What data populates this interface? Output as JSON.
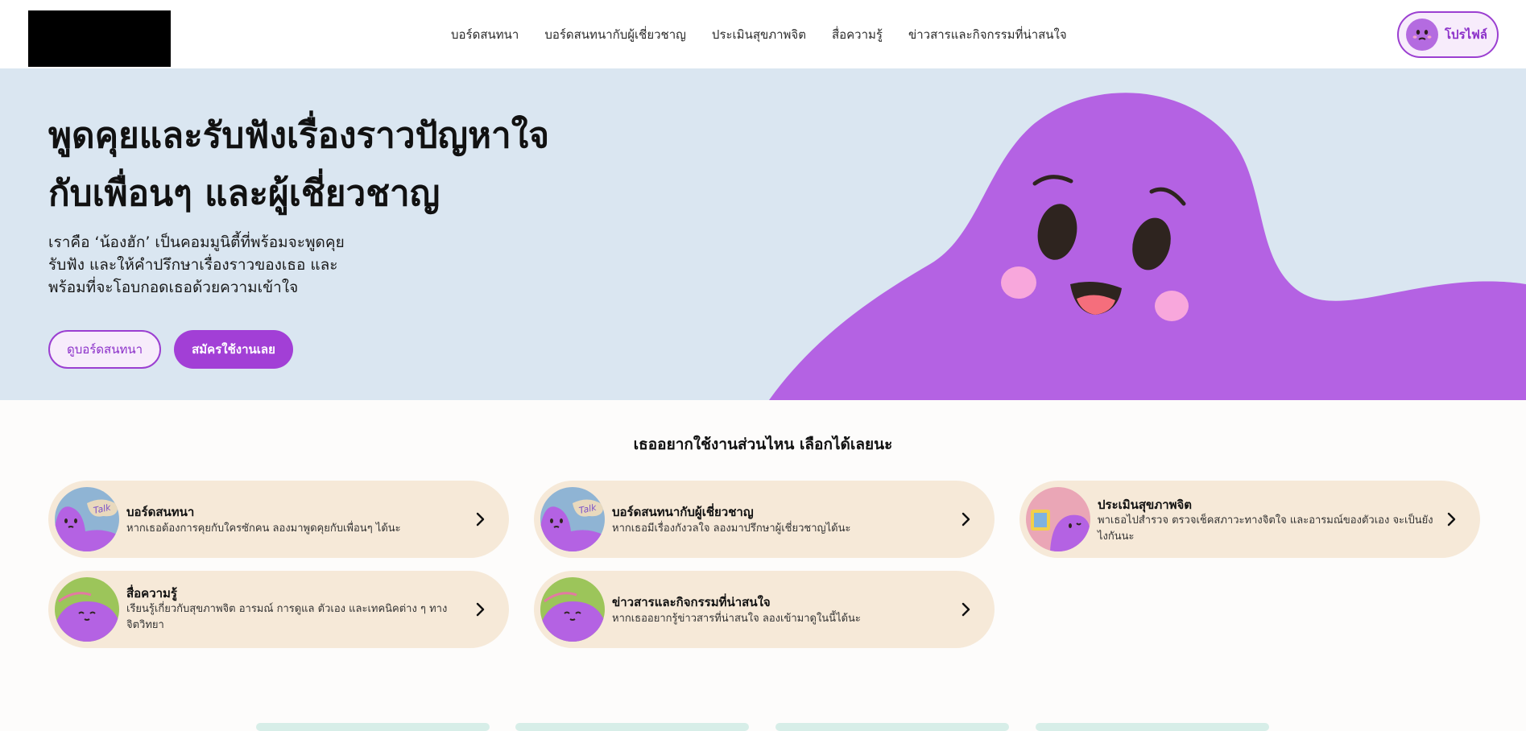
{
  "header": {
    "nav": [
      {
        "label": "บอร์ดสนทนา"
      },
      {
        "label": "บอร์ดสนทนากับผู้เชี่ยวชาญ"
      },
      {
        "label": "ประเมินสุขภาพจิต"
      },
      {
        "label": "สื่อความรู้"
      },
      {
        "label": "ข่าวสารและกิจกรรมที่น่าสนใจ"
      }
    ],
    "profile_label": "โปรไฟล์"
  },
  "hero": {
    "title_lines": [
      "พูดคุยและรับฟังเรื่องราวปัญหาใจ",
      "กับเพื่อนๆ และผู้เชี่ยวชาญ"
    ],
    "desc_lines": [
      "เราคือ ‘น้องฮัก’ เป็นคอมมูนิตี้ที่พร้อมจะพูดคุย",
      "รับฟัง และให้คำปรึกษาเรื่องราวของเธอ และ",
      "พร้อมที่จะโอบกอดเธอด้วยความเข้าใจ"
    ],
    "btn_outline": "ดูบอร์ดสนทนา",
    "btn_fill": "สมัครใช้งานเลย"
  },
  "section": {
    "title": "เธออยากใช้งานส่วนไหน เลือกได้เลยนะ",
    "cards": [
      {
        "title": "บอร์ดสนทนา",
        "desc_lines": [
          "หากเธอต้องการคุยกับใครซักคน ลองมาพูดคุยกับเพื่อนๆ ได้นะ"
        ],
        "thumb_text": "Talk"
      },
      {
        "title": "บอร์ดสนทนากับผู้เชี่ยวชาญ",
        "desc_lines": [
          "หากเธอมีเรื่องกังวลใจ ลองมาปรึกษาผู้เชี่ยวชาญได้นะ"
        ],
        "thumb_text": "Talk"
      },
      {
        "title": "ประเมินสุขภาพจิต",
        "desc_lines": [
          "พาเธอไปสำรวจ ตรวจเช็คสภาวะทางจิตใจ และอารมณ์ของตัวเอง จะเป็นยัง",
          "ไงกันนะ"
        ]
      },
      {
        "title": "สื่อความรู้",
        "desc_lines": [
          "เรียนรู้เกี่ยวกับสุขภาพจิต อารมณ์ การดูแล ตัวเอง และเทคนิคต่าง ๆ ทาง",
          "จิตวิทยา"
        ]
      },
      {
        "title": "ข่าวสารและกิจกรรมที่น่าสนใจ",
        "desc_lines": [
          "หากเธออยากรู้ข่าวสารที่น่าสนใจ ลองเข้ามาดูในนี้ได้นะ"
        ]
      }
    ]
  },
  "colors": {
    "accent": "#a23fd6",
    "blob": "#b462e3",
    "hero_bg": "#dae6f1",
    "card_bg": "#f6e9d8"
  },
  "icons": [
    "logo-block",
    "profile-avatar-icon",
    "chevron-right-icon",
    "talk-mascot-icon",
    "assessment-mascot-icon",
    "media-mascot-icon"
  ]
}
